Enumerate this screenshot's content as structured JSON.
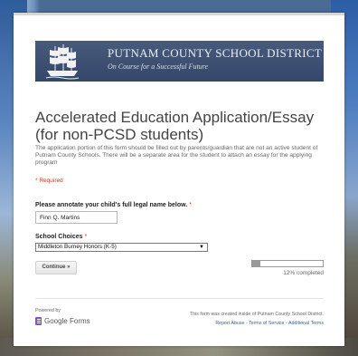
{
  "banner": {
    "title": "PUTNAM COUNTY SCHOOL DISTRICT",
    "subtitle": "On Course for a Successful Future"
  },
  "form": {
    "title": "Accelerated Education Application/Essay (for non-PCSD students)",
    "description": "The application portion of this form should be filled out by parents/guardian that are not an active student of Putnam County Schools.  There will be a separate area for the student to attach an essay for the applying program",
    "required_note": "* Required"
  },
  "questions": {
    "name": {
      "label": "Please annotate your child's full legal name below.",
      "required_marker": "*",
      "value": "Finn Q. Martins"
    },
    "school": {
      "label": "School Choices",
      "required_marker": "*",
      "selected": "Middleton Burney Honors (K-5)"
    }
  },
  "actions": {
    "continue_label": "Continue »"
  },
  "progress": {
    "fraction": 0.12,
    "text": "12% completed"
  },
  "footer": {
    "powered_by": "Powered by",
    "logo_text": "Google Forms",
    "note": "This form was created inside of Putnam County School District.",
    "links": [
      "Report Abuse",
      "Terms of Service",
      "Additional Terms"
    ],
    "separator": " - "
  },
  "colors": {
    "banner_bg": "#3d4f6e",
    "required": "#c43b1d",
    "link": "#3b62a8",
    "forms_purple": "#7e57c2"
  }
}
